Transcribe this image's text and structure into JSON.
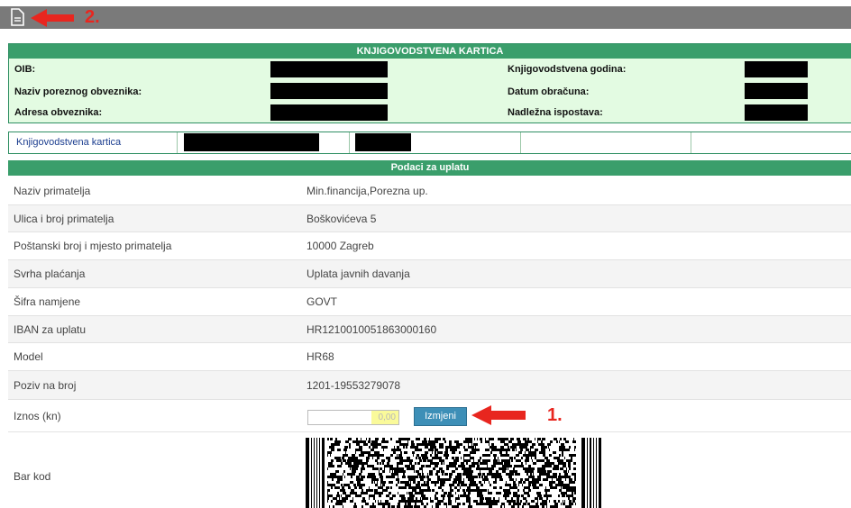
{
  "top": {
    "marker_2": "2.",
    "marker_1": "1."
  },
  "card": {
    "title": "KNJIGOVODSTVENA KARTICA",
    "labels": {
      "oib": "OIB:",
      "naziv": "Naziv poreznog obveznika:",
      "adresa": "Adresa obveznika:",
      "godina": "Knjigovodstvena godina:",
      "datum": "Datum obračuna:",
      "ispostava": "Nadležna ispostava:"
    }
  },
  "kartica_row": {
    "label": "Knjigovodstvena kartica"
  },
  "payment": {
    "title": "Podaci za uplatu",
    "rows": [
      {
        "label": "Naziv primatelja",
        "value": "Min.financija,Porezna up."
      },
      {
        "label": "Ulica i broj primatelja",
        "value": "Boškovićeva 5"
      },
      {
        "label": "Poštanski broj i mjesto primatelja",
        "value": "10000 Zagreb"
      },
      {
        "label": "Svrha plaćanja",
        "value": "Uplata javnih davanja"
      },
      {
        "label": "Šifra namjene",
        "value": "GOVT"
      },
      {
        "label": "IBAN za uplatu",
        "value": "HR1210010051863000160"
      },
      {
        "label": "Model",
        "value": "HR68"
      },
      {
        "label": "Poziv na broj",
        "value": "1201-19553279078"
      }
    ],
    "amount_label": "Iznos (kn)",
    "amount_value": "0,00",
    "edit_button": "Izmjeni",
    "barcode_label": "Bar kod"
  },
  "colors": {
    "header_green": "#3a9e6b",
    "card_bg": "#e3fbe2",
    "button_blue": "#3d8fb7",
    "annotation_red": "#e8261f"
  }
}
